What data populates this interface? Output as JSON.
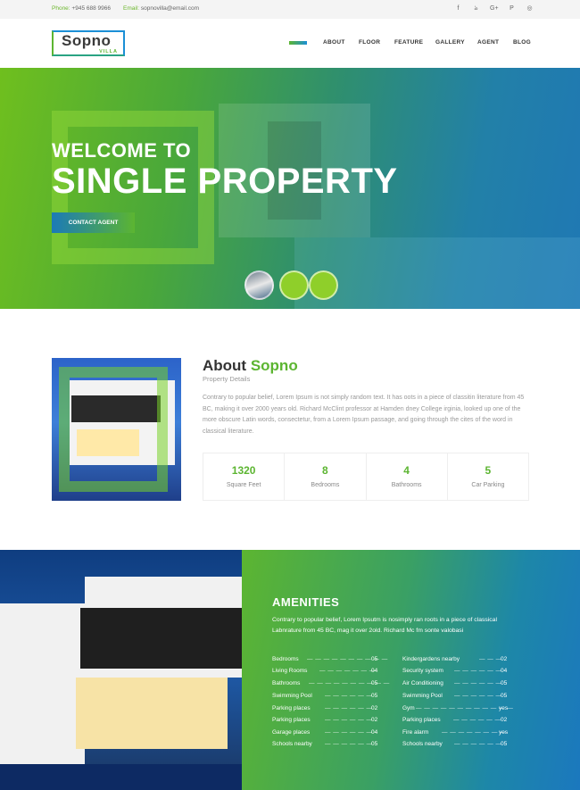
{
  "topbar": {
    "phone_label": "Phone:",
    "phone": "+945 688 9966",
    "email_label": "Email:",
    "email": "sopnovilla@email.com",
    "social_icons": [
      "f",
      "ঌ",
      "G+",
      "P",
      "◎"
    ]
  },
  "header": {
    "logo_main": "Sopno",
    "logo_sub": "VILLA",
    "nav": [
      "ABOUT",
      "FLOOR",
      "FEATURE",
      "GALLERY",
      "AGENT",
      "BLOG"
    ]
  },
  "hero": {
    "welcome": "WELCOME TO",
    "title": "SINGLE PROPERTY",
    "cta": "CONTACT AGENT"
  },
  "about": {
    "title_a": "About",
    "title_b": "Sopno",
    "subtitle": "Property Details",
    "text": "Contrary to popular belief, Lorem Ipsum is not simply random text. It has oots in a piece of classitin literature from 45 BC, making it over 2000 years old. Richard McClint professor at Hamden dney College irginia, looked up one of the more obscure Latin words, consectetur, from a Lorem Ipsum passage, and going through the cites of the word in classical literature.",
    "stats": [
      {
        "value": "1320",
        "label": "Square Feet"
      },
      {
        "value": "8",
        "label": "Bedrooms"
      },
      {
        "value": "4",
        "label": "Bathrooms"
      },
      {
        "value": "5",
        "label": "Car Parking"
      }
    ]
  },
  "amenities": {
    "title": "AMENITIES",
    "text": "Contrary to popular belief, Lorem Ipsutm is nosimply ran roots in a piece of classical Labnrature from 45 BC, mag it over 2old. Richard Mc fm sonte valobasi",
    "left": [
      {
        "label": "Bedrooms",
        "value": "05"
      },
      {
        "label": "Living Rooms",
        "value": "04"
      },
      {
        "label": "Bathrooms",
        "value": "05"
      },
      {
        "label": "Swimming Pool",
        "value": "05"
      },
      {
        "label": "Parking places",
        "value": "02"
      },
      {
        "label": "Parking places",
        "value": "02"
      },
      {
        "label": "Garage places",
        "value": "04"
      },
      {
        "label": "Schools nearby",
        "value": "05"
      }
    ],
    "right": [
      {
        "label": "Kindergardens nearby",
        "value": "02"
      },
      {
        "label": "Security system",
        "value": "04"
      },
      {
        "label": "Air Conditioning",
        "value": "05"
      },
      {
        "label": "Swimming Pool",
        "value": "05"
      },
      {
        "label": "Gym",
        "value": "yes"
      },
      {
        "label": "Parking places",
        "value": "02"
      },
      {
        "label": "Fire alarm",
        "value": "yes"
      },
      {
        "label": "Schools nearby",
        "value": "05"
      }
    ]
  }
}
